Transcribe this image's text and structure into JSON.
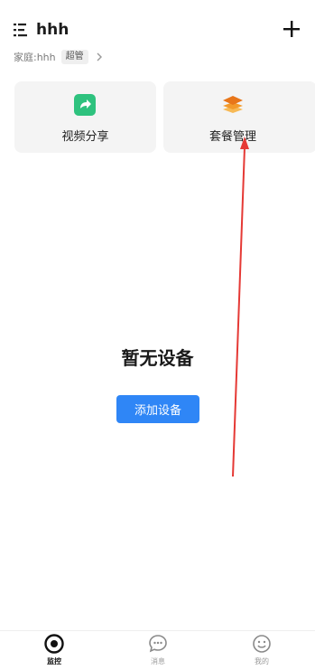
{
  "header": {
    "home_name": "hhh",
    "family_label": "家庭:hhh",
    "role_badge": "超管"
  },
  "quick_actions": [
    {
      "label": "视频分享",
      "icon": "share-arrow-icon",
      "color": "#2ec27e"
    },
    {
      "label": "套餐管理",
      "icon": "layers-icon",
      "color": "#f5a623"
    }
  ],
  "empty_state": {
    "title": "暂无设备",
    "add_button": "添加设备"
  },
  "tabs": [
    {
      "label": "监控",
      "icon": "monitor-eye-icon",
      "active": true
    },
    {
      "label": "消息",
      "icon": "chat-bubble-icon",
      "active": false
    },
    {
      "label": "我的",
      "icon": "smiley-face-icon",
      "active": false
    }
  ],
  "colors": {
    "accent": "#2f86f6",
    "annotation_arrow": "#e53935"
  }
}
